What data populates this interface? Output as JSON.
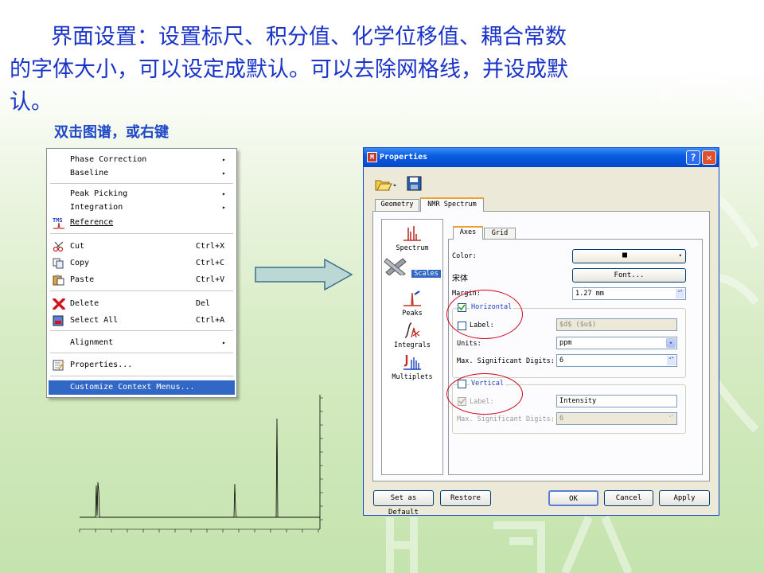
{
  "slide": {
    "title_line1": "界面设置：设置标尺、积分值、化学位移值、耦合常数",
    "title_line2": "的字体大小，可以设定成默认。可以去除网格线，并设成默",
    "title_line3": "认。",
    "subtitle": "双击图谱，或右键"
  },
  "context_menu": {
    "items": [
      {
        "label": "Phase Correction",
        "shortcut": "",
        "submenu": true
      },
      {
        "label": "Baseline",
        "shortcut": "",
        "submenu": true
      },
      {
        "label": "Peak Picking",
        "shortcut": "",
        "submenu": true
      },
      {
        "label": "Integration",
        "shortcut": "",
        "submenu": true
      },
      {
        "label": "Reference",
        "shortcut": "",
        "submenu": false
      },
      {
        "label": "Cut",
        "shortcut": "Ctrl+X",
        "submenu": false
      },
      {
        "label": "Copy",
        "shortcut": "Ctrl+C",
        "submenu": false
      },
      {
        "label": "Paste",
        "shortcut": "Ctrl+V",
        "submenu": false
      },
      {
        "label": "Delete",
        "shortcut": "Del",
        "submenu": false
      },
      {
        "label": "Select All",
        "shortcut": "Ctrl+A",
        "submenu": false
      },
      {
        "label": "Alignment",
        "shortcut": "",
        "submenu": true
      },
      {
        "label": "Properties...",
        "shortcut": "",
        "submenu": false
      },
      {
        "label": "Customize Context Menus...",
        "shortcut": "",
        "submenu": false
      }
    ],
    "reference_icon_text": "TMS",
    "submenu_glyph": "▸"
  },
  "dialog": {
    "title": "Properties",
    "app_icon_letter": "M",
    "help_glyph": "?",
    "close_glyph": "✕",
    "tabs": [
      "Geometry",
      "NMR Spectrum"
    ],
    "side_items": [
      "Spectrum",
      "Scales",
      "Peaks",
      "Integrals",
      "Multiplets"
    ],
    "subtabs": [
      "Axes",
      "Grid"
    ],
    "color_label": "Color:",
    "color_value": "■",
    "font_name": "宋体",
    "font_button": "Font...",
    "margin_label": "Margin:",
    "margin_value": "1.27 mm",
    "horizontal_label": "Horizontal",
    "horizontal_checked": true,
    "h_label_label": "Label:",
    "h_label_value": "$d$ ($u$)",
    "units_label": "Units:",
    "units_value": "ppm",
    "h_digits_label": "Max. Significant Digits:",
    "h_digits_value": "6",
    "vertical_label": "Vertical",
    "vertical_checked": false,
    "v_label_label": "Label:",
    "v_label_value": "Intensity",
    "v_digits_label": "Max. Significant Digits:",
    "v_digits_value": "6",
    "set_default": "Set as Default",
    "restore": "Restore",
    "ok": "OK",
    "cancel": "Cancel",
    "apply": "Apply",
    "dropdown_glyph": "▾",
    "spin_glyph": "▴▾"
  },
  "colors": {
    "title_text": "#1a33c8",
    "highlight": "#3168c6",
    "annotation_ring": "#d0021b",
    "xp_titlebar": "#0a5de0"
  }
}
